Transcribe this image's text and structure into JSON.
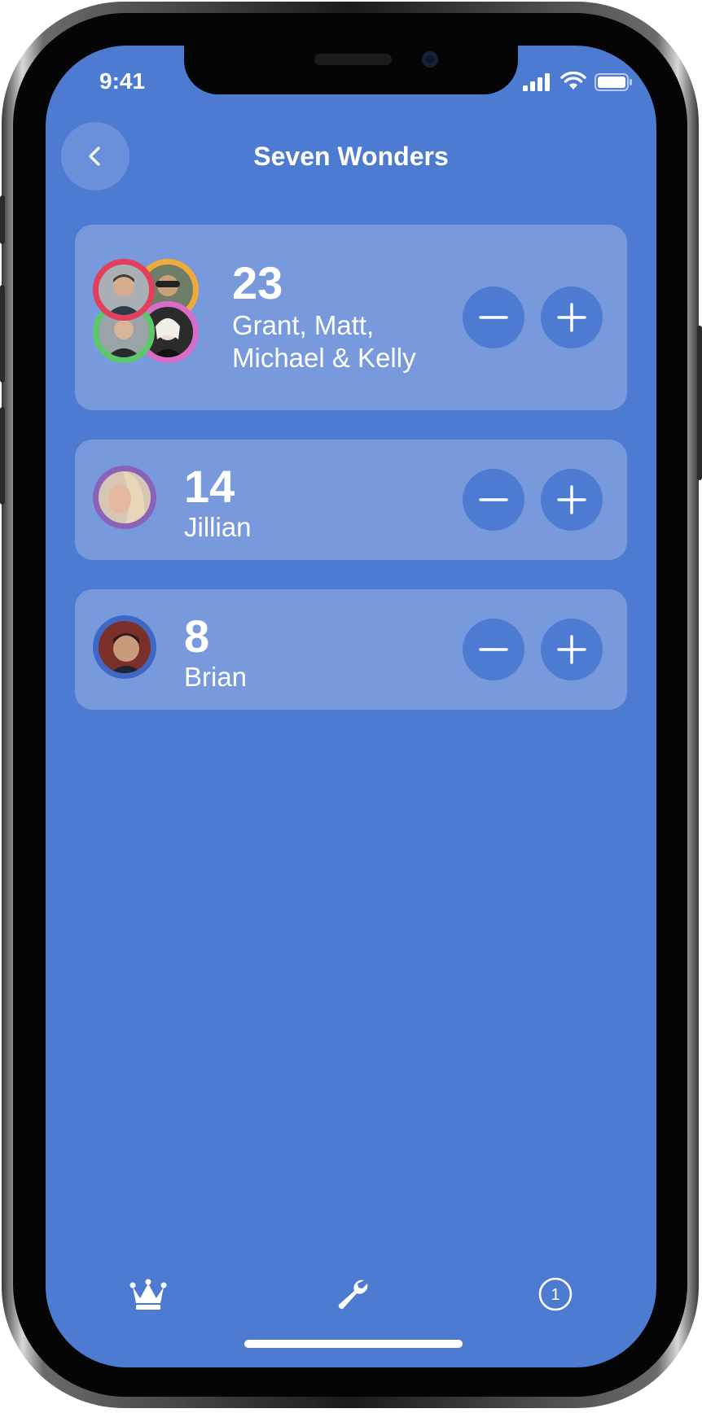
{
  "status": {
    "time": "9:41"
  },
  "nav": {
    "title": "Seven Wonders",
    "back_icon": "chevron-left-icon"
  },
  "colors": {
    "background": "#4e7bd2",
    "card": "#7a9ce0",
    "ring_red": "#e0405c",
    "ring_orange": "#eeaa3a",
    "ring_green": "#5cc86a",
    "ring_pink": "#d86cc8",
    "ring_purple": "#8a63b8",
    "ring_blue": "#3f68c6"
  },
  "players": [
    {
      "score": "23",
      "names_line1": "Grant, Matt,",
      "names_line2": "Michael & Kelly"
    },
    {
      "score": "14",
      "names": "Jillian"
    },
    {
      "score": "8",
      "names": "Brian"
    }
  ],
  "tabbar": {
    "icons": [
      "crown-icon",
      "wrench-icon",
      "info-number-icon"
    ],
    "info_number": "1"
  }
}
